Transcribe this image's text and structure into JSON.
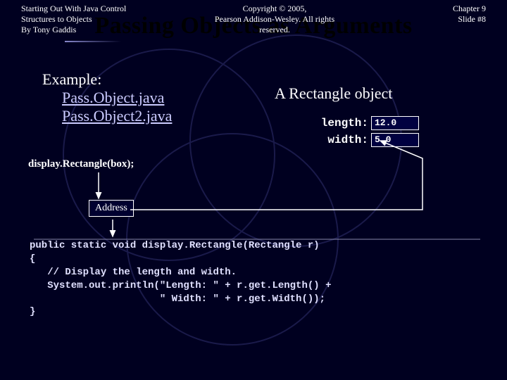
{
  "title": "Passing Objects as Arguments",
  "example": {
    "label": "Example:",
    "link1": "Pass.Object.java",
    "link2": "Pass.Object2.java"
  },
  "call_label": "display.Rectangle(box);",
  "object": {
    "title": "A Rectangle object",
    "length_label": "length:",
    "length_value": "12.0",
    "width_label": "width:",
    "width_value": "5.0"
  },
  "address_label": "Address",
  "code": "public static void display.Rectangle(Rectangle r)\n{\n   // Display the length and width.\n   System.out.println(\"Length: \" + r.get.Length() +\n                      \" Width: \" + r.get.Width());\n}",
  "footer": {
    "left": "Starting Out With Java Control\nStructures to Objects\nBy Tony Gaddis",
    "mid": "Copyright © 2005,\nPearson Addison-Wesley. All rights\nreserved.",
    "right": "Chapter 9\nSlide #8"
  }
}
